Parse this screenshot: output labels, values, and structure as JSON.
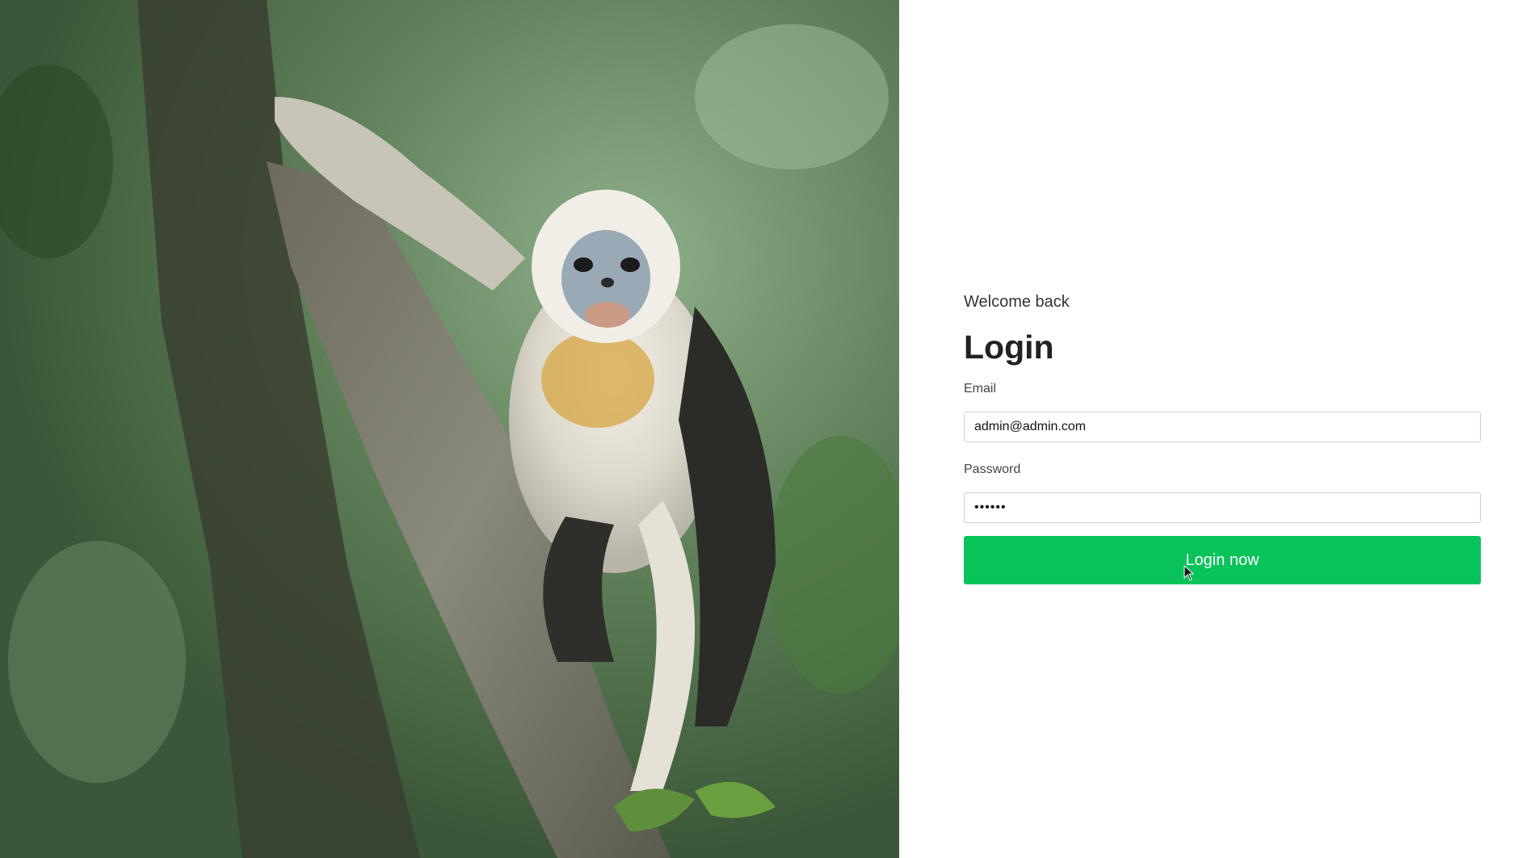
{
  "hero": {
    "image_alt": "monkey-on-tree-photo"
  },
  "login": {
    "welcome": "Welcome back",
    "title": "Login",
    "email_label": "Email",
    "email_value": "admin@admin.com",
    "password_label": "Password",
    "password_value": "••••••",
    "submit_label": "Login now"
  },
  "colors": {
    "accent": "#08c35a",
    "background": "#ffffff",
    "text": "#222222"
  }
}
